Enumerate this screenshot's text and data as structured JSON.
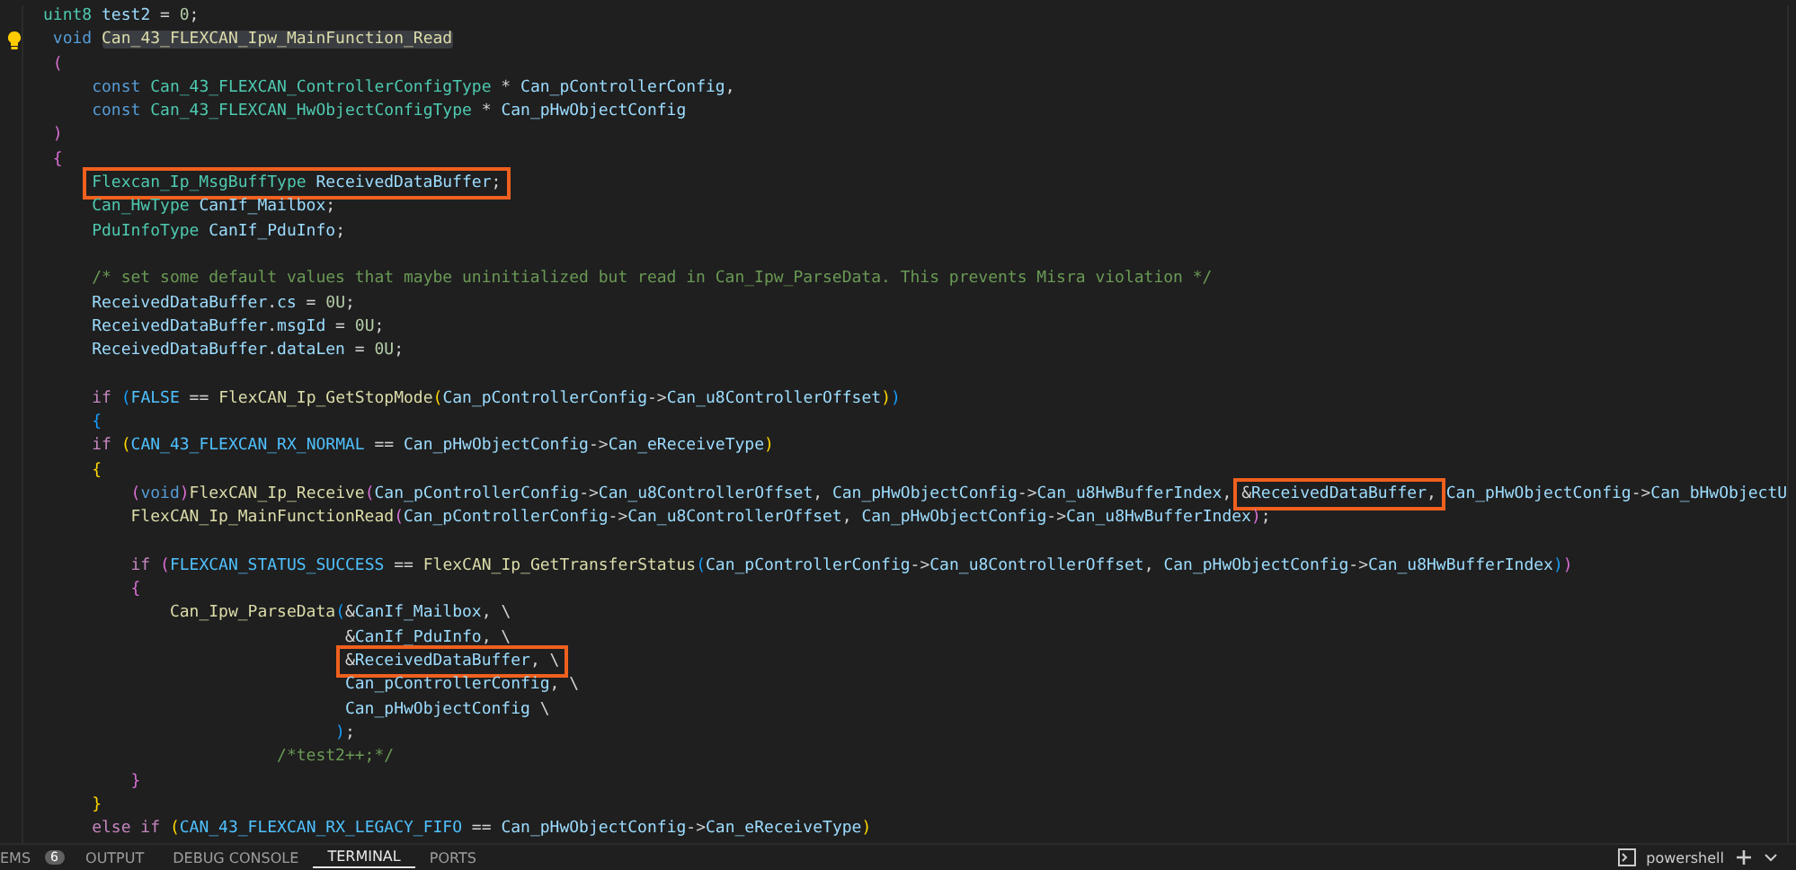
{
  "editor": {
    "lines": [
      {
        "lightbulb": false,
        "tokens": [
          {
            "kind": "type",
            "text": "uint8 "
          },
          {
            "kind": "var",
            "text": "test2"
          },
          {
            "kind": "op",
            "text": " = "
          },
          {
            "kind": "num",
            "text": "0"
          },
          {
            "kind": "op",
            "text": ";"
          }
        ]
      },
      {
        "lightbulb": true,
        "tokens": [
          {
            "kind": "kw",
            "text": " void "
          },
          {
            "kind": "fn",
            "text": "Can_43_FLEXCAN_Ipw_MainFunction_Read",
            "highlighted": true
          }
        ]
      },
      {
        "lightbulb": false,
        "tokens": [
          {
            "kind": "b2",
            "text": " ("
          }
        ]
      },
      {
        "lightbulb": false,
        "tokens": [
          {
            "kind": "kw",
            "text": "     const "
          },
          {
            "kind": "type",
            "text": "Can_43_FLEXCAN_ControllerConfigType"
          },
          {
            "kind": "op",
            "text": " * "
          },
          {
            "kind": "var",
            "text": "Can_pControllerConfig"
          },
          {
            "kind": "op",
            "text": ","
          }
        ]
      },
      {
        "lightbulb": false,
        "tokens": [
          {
            "kind": "kw",
            "text": "     const "
          },
          {
            "kind": "type",
            "text": "Can_43_FLEXCAN_HwObjectConfigType"
          },
          {
            "kind": "op",
            "text": " * "
          },
          {
            "kind": "var",
            "text": "Can_pHwObjectConfig"
          }
        ]
      },
      {
        "lightbulb": false,
        "tokens": [
          {
            "kind": "b2",
            "text": " )"
          }
        ]
      },
      {
        "lightbulb": false,
        "tokens": [
          {
            "kind": "b2",
            "text": " {"
          }
        ]
      },
      {
        "lightbulb": false,
        "tokens": [
          {
            "kind": "box",
            "tokens": [
              {
                "kind": "type",
                "text": "Flexcan_Ip_MsgBuffType "
              },
              {
                "kind": "var",
                "text": "ReceivedDataBuffer"
              },
              {
                "kind": "op",
                "text": ";"
              }
            ]
          }
        ]
      },
      {
        "lightbulb": false,
        "tokens": [
          {
            "kind": "type",
            "text": "     Can_HwType "
          },
          {
            "kind": "var",
            "text": "CanIf_Mailbox"
          },
          {
            "kind": "op",
            "text": ";"
          }
        ]
      },
      {
        "lightbulb": false,
        "tokens": [
          {
            "kind": "type",
            "text": "     PduInfoType "
          },
          {
            "kind": "var",
            "text": "CanIf_PduInfo"
          },
          {
            "kind": "op",
            "text": ";"
          }
        ]
      },
      {
        "lightbulb": false
      },
      {
        "lightbulb": false,
        "tokens": [
          {
            "kind": "cm",
            "text": "     /* set some default values that maybe uninitialized but read in Can_Ipw_ParseData. This prevents Misra violation */"
          }
        ]
      },
      {
        "lightbulb": false,
        "tokens": [
          {
            "kind": "var",
            "text": "     ReceivedDataBuffer"
          },
          {
            "kind": "op",
            "text": "."
          },
          {
            "kind": "var",
            "text": "cs"
          },
          {
            "kind": "op",
            "text": " = "
          },
          {
            "kind": "num",
            "text": "0U"
          },
          {
            "kind": "op",
            "text": ";"
          }
        ]
      },
      {
        "lightbulb": false,
        "tokens": [
          {
            "kind": "var",
            "text": "     ReceivedDataBuffer"
          },
          {
            "kind": "op",
            "text": "."
          },
          {
            "kind": "var",
            "text": "msgId"
          },
          {
            "kind": "op",
            "text": " = "
          },
          {
            "kind": "num",
            "text": "0U"
          },
          {
            "kind": "op",
            "text": ";"
          }
        ]
      },
      {
        "lightbulb": false,
        "tokens": [
          {
            "kind": "var",
            "text": "     ReceivedDataBuffer"
          },
          {
            "kind": "op",
            "text": "."
          },
          {
            "kind": "var",
            "text": "dataLen"
          },
          {
            "kind": "op",
            "text": " = "
          },
          {
            "kind": "num",
            "text": "0U"
          },
          {
            "kind": "op",
            "text": ";"
          }
        ]
      },
      {
        "lightbulb": false
      },
      {
        "lightbulb": false,
        "tokens": [
          {
            "kind": "ctrl",
            "text": "     if "
          },
          {
            "kind": "b3",
            "text": "("
          },
          {
            "kind": "macro",
            "text": "FALSE"
          },
          {
            "kind": "op",
            "text": " == "
          },
          {
            "kind": "fn",
            "text": "FlexCAN_Ip_GetStopMode"
          },
          {
            "kind": "b1",
            "text": "("
          },
          {
            "kind": "var",
            "text": "Can_pControllerConfig"
          },
          {
            "kind": "op",
            "text": "->"
          },
          {
            "kind": "var",
            "text": "Can_u8ControllerOffset"
          },
          {
            "kind": "b1",
            "text": ")"
          },
          {
            "kind": "b3",
            "text": ")"
          }
        ]
      },
      {
        "lightbulb": false,
        "tokens": [
          {
            "kind": "b3",
            "text": "     {"
          }
        ]
      },
      {
        "lightbulb": false,
        "tokens": [
          {
            "kind": "ctrl",
            "text": "     if "
          },
          {
            "kind": "b1",
            "text": "("
          },
          {
            "kind": "macro",
            "text": "CAN_43_FLEXCAN_RX_NORMAL"
          },
          {
            "kind": "op",
            "text": " == "
          },
          {
            "kind": "var",
            "text": "Can_pHwObjectConfig"
          },
          {
            "kind": "op",
            "text": "->"
          },
          {
            "kind": "var",
            "text": "Can_eReceiveType"
          },
          {
            "kind": "b1",
            "text": ")"
          }
        ]
      },
      {
        "lightbulb": false,
        "tokens": [
          {
            "kind": "b1",
            "text": "     {"
          }
        ]
      },
      {
        "lightbulb": false,
        "tokens": [
          {
            "kind": "b2",
            "text": "         ("
          },
          {
            "kind": "kw",
            "text": "void"
          },
          {
            "kind": "b2",
            "text": ")"
          },
          {
            "kind": "fn",
            "text": "FlexCAN_Ip_Receive"
          },
          {
            "kind": "b2",
            "text": "("
          },
          {
            "kind": "var",
            "text": "Can_pControllerConfig"
          },
          {
            "kind": "op",
            "text": "->"
          },
          {
            "kind": "var",
            "text": "Can_u8ControllerOffset"
          },
          {
            "kind": "op",
            "text": ", "
          },
          {
            "kind": "var",
            "text": "Can_pHwObjectConfig"
          },
          {
            "kind": "op",
            "text": "->"
          },
          {
            "kind": "var",
            "text": "Can_u8HwBufferIndex"
          },
          {
            "kind": "op",
            "text": ", "
          },
          {
            "kind": "box",
            "tokens": [
              {
                "kind": "op",
                "text": "&"
              },
              {
                "kind": "var",
                "text": "ReceivedDataBuffer"
              },
              {
                "kind": "op",
                "text": ","
              }
            ]
          },
          {
            "kind": "var",
            "text": " Can_pHwObjectConfig"
          },
          {
            "kind": "op",
            "text": "->"
          },
          {
            "kind": "var",
            "text": "Can_bHwObjectU"
          }
        ]
      },
      {
        "lightbulb": false,
        "tokens": [
          {
            "kind": "fn",
            "text": "         FlexCAN_Ip_MainFunctionRead"
          },
          {
            "kind": "b2",
            "text": "("
          },
          {
            "kind": "var",
            "text": "Can_pControllerConfig"
          },
          {
            "kind": "op",
            "text": "->"
          },
          {
            "kind": "var",
            "text": "Can_u8ControllerOffset"
          },
          {
            "kind": "op",
            "text": ", "
          },
          {
            "kind": "var",
            "text": "Can_pHwObjectConfig"
          },
          {
            "kind": "op",
            "text": "->"
          },
          {
            "kind": "var",
            "text": "Can_u8HwBufferIndex"
          },
          {
            "kind": "b2",
            "text": ")"
          },
          {
            "kind": "op",
            "text": ";"
          }
        ]
      },
      {
        "lightbulb": false
      },
      {
        "lightbulb": false,
        "tokens": [
          {
            "kind": "ctrl",
            "text": "         if "
          },
          {
            "kind": "b2",
            "text": "("
          },
          {
            "kind": "macro",
            "text": "FLEXCAN_STATUS_SUCCESS"
          },
          {
            "kind": "op",
            "text": " == "
          },
          {
            "kind": "fn",
            "text": "FlexCAN_Ip_GetTransferStatus"
          },
          {
            "kind": "b3",
            "text": "("
          },
          {
            "kind": "var",
            "text": "Can_pControllerConfig"
          },
          {
            "kind": "op",
            "text": "->"
          },
          {
            "kind": "var",
            "text": "Can_u8ControllerOffset"
          },
          {
            "kind": "op",
            "text": ", "
          },
          {
            "kind": "var",
            "text": "Can_pHwObjectConfig"
          },
          {
            "kind": "op",
            "text": "->"
          },
          {
            "kind": "var",
            "text": "Can_u8HwBufferIndex"
          },
          {
            "kind": "b3",
            "text": ")"
          },
          {
            "kind": "b2",
            "text": ")"
          }
        ]
      },
      {
        "lightbulb": false,
        "tokens": [
          {
            "kind": "b2",
            "text": "         {"
          }
        ]
      },
      {
        "lightbulb": false,
        "tokens": [
          {
            "kind": "fn",
            "text": "             Can_Ipw_ParseData"
          },
          {
            "kind": "b3",
            "text": "("
          },
          {
            "kind": "op",
            "text": "&"
          },
          {
            "kind": "var",
            "text": "CanIf_Mailbox"
          },
          {
            "kind": "op",
            "text": ", \\"
          }
        ]
      },
      {
        "lightbulb": false,
        "tokens": [
          {
            "kind": "op",
            "text": "                               &"
          },
          {
            "kind": "var",
            "text": "CanIf_PduInfo"
          },
          {
            "kind": "op",
            "text": ", \\"
          }
        ]
      },
      {
        "lightbulb": false,
        "tokens": [
          {
            "kind": "box",
            "tokens": [
              {
                "kind": "op",
                "text": "&"
              },
              {
                "kind": "var",
                "text": "ReceivedDataBuffer"
              },
              {
                "kind": "op",
                "text": ", \\"
              }
            ]
          }
        ]
      },
      {
        "lightbulb": false,
        "tokens": [
          {
            "kind": "var",
            "text": "                               Can_pControllerConfig"
          },
          {
            "kind": "op",
            "text": ", \\"
          }
        ]
      },
      {
        "lightbulb": false,
        "tokens": [
          {
            "kind": "var",
            "text": "                               Can_pHwObjectConfig"
          },
          {
            "kind": "op",
            "text": " \\"
          }
        ]
      },
      {
        "lightbulb": false,
        "tokens": [
          {
            "kind": "b3",
            "text": "                              )"
          },
          {
            "kind": "op",
            "text": ";"
          }
        ]
      },
      {
        "lightbulb": false,
        "tokens": [
          {
            "kind": "cm",
            "text": "                        /*test2++;*/"
          }
        ]
      },
      {
        "lightbulb": false,
        "tokens": [
          {
            "kind": "b2",
            "text": "         }"
          }
        ]
      },
      {
        "lightbulb": false,
        "tokens": [
          {
            "kind": "b1",
            "text": "     }"
          }
        ]
      },
      {
        "lightbulb": false,
        "tokens": [
          {
            "kind": "ctrl",
            "text": "     else if "
          },
          {
            "kind": "b1",
            "text": "("
          },
          {
            "kind": "macro",
            "text": "CAN_43_FLEXCAN_RX_LEGACY_FIFO"
          },
          {
            "kind": "op",
            "text": " == "
          },
          {
            "kind": "var",
            "text": "Can_pHwObjectConfig"
          },
          {
            "kind": "op",
            "text": "->"
          },
          {
            "kind": "var",
            "text": "Can_eReceiveType"
          },
          {
            "kind": "b1",
            "text": ")"
          }
        ]
      }
    ]
  },
  "panel": {
    "tabs": [
      {
        "label": "EMS",
        "badge": "6",
        "selected": false
      },
      {
        "label": "OUTPUT",
        "selected": false
      },
      {
        "label": "DEBUG CONSOLE",
        "selected": false
      },
      {
        "label": "TERMINAL",
        "selected": true
      },
      {
        "label": "PORTS",
        "selected": false
      }
    ],
    "terminal_name": "powershell"
  }
}
